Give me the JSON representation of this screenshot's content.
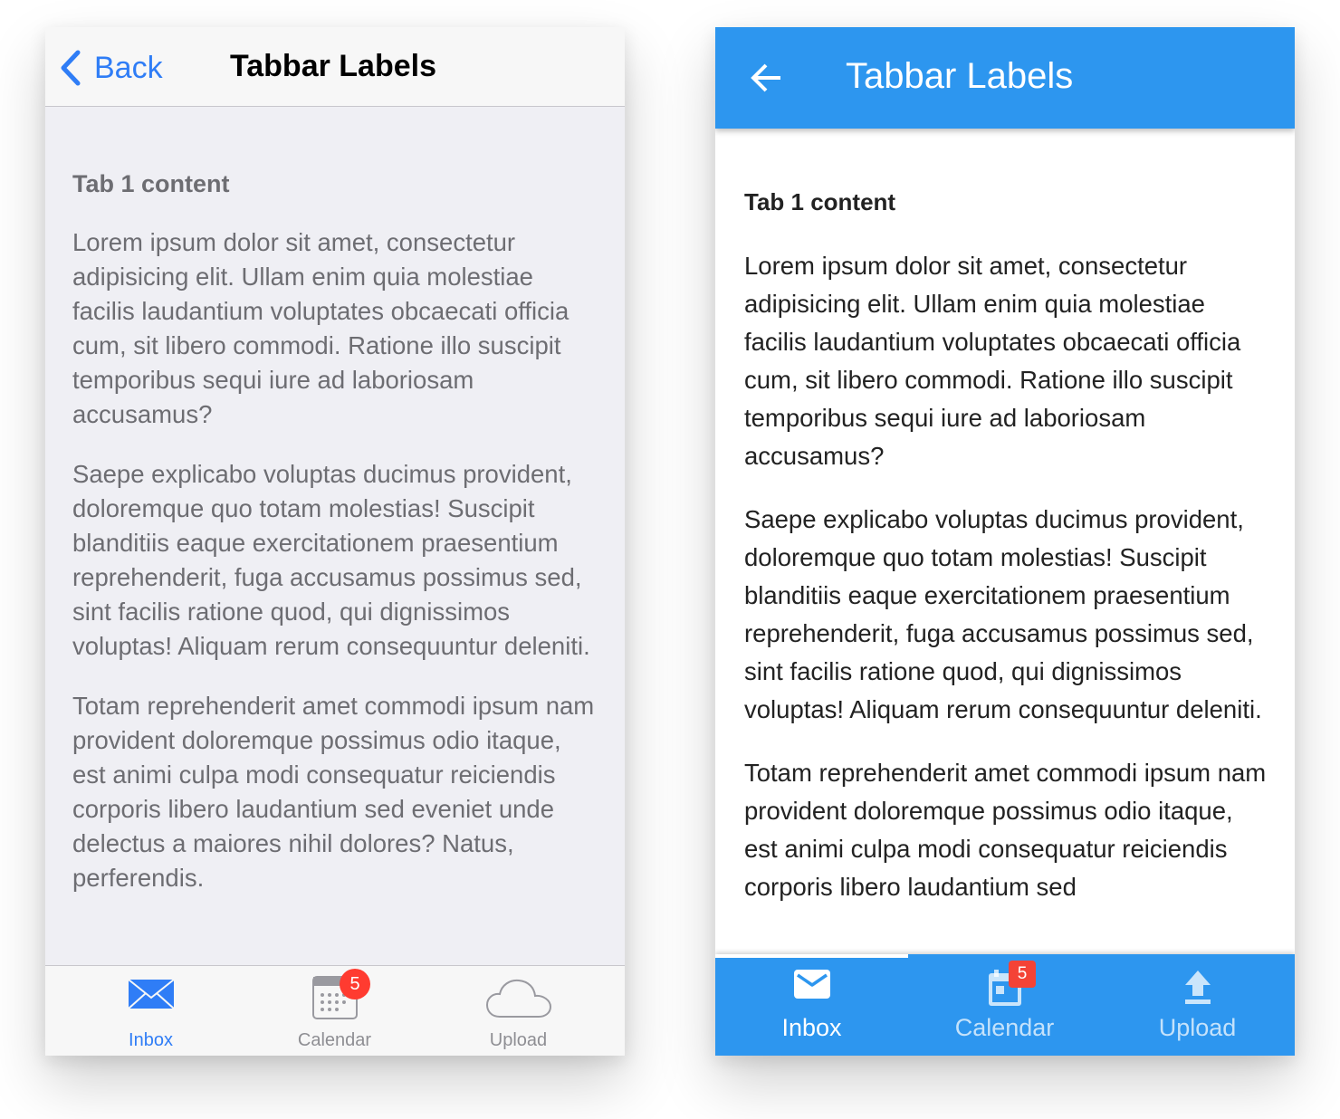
{
  "ios": {
    "nav": {
      "back_label": "Back",
      "title": "Tabbar Labels"
    },
    "content": {
      "heading": "Tab 1 content",
      "paragraphs": [
        "Lorem ipsum dolor sit amet, consectetur adipisicing elit. Ullam enim quia molestiae facilis laudantium voluptates obcaecati officia cum, sit libero commodi. Ratione illo suscipit temporibus sequi iure ad laboriosam accusamus?",
        "Saepe explicabo voluptas ducimus provident, doloremque quo totam molestias! Suscipit blanditiis eaque exercitationem praesentium reprehenderit, fuga accusamus possimus sed, sint facilis ratione quod, qui dignissimos voluptas! Aliquam rerum consequuntur deleniti.",
        "Totam reprehenderit amet commodi ipsum nam provident doloremque possimus odio itaque, est animi culpa modi consequatur reiciendis corporis libero laudantium sed eveniet unde delectus a maiores nihil dolores? Natus, perferendis."
      ]
    },
    "tabs": [
      {
        "label": "Inbox",
        "icon": "envelope-icon",
        "active": true
      },
      {
        "label": "Calendar",
        "icon": "calendar-icon",
        "badge": "5"
      },
      {
        "label": "Upload",
        "icon": "cloud-icon"
      }
    ],
    "colors": {
      "accent": "#2f7df6",
      "badge": "#ff3b30"
    }
  },
  "android": {
    "toolbar": {
      "title": "Tabbar Labels",
      "back_icon": "arrow-back-icon"
    },
    "content": {
      "heading": "Tab 1 content",
      "paragraphs": [
        "Lorem ipsum dolor sit amet, consectetur adipisicing elit. Ullam enim quia molestiae facilis laudantium voluptates obcaecati officia cum, sit libero commodi. Ratione illo suscipit temporibus sequi iure ad laboriosam accusamus?",
        "Saepe explicabo voluptas ducimus provident, doloremque quo totam molestias! Suscipit blanditiis eaque exercitationem praesentium reprehenderit, fuga accusamus possimus sed, sint facilis ratione quod, qui dignissimos voluptas! Aliquam rerum consequuntur deleniti.",
        "Totam reprehenderit amet commodi ipsum nam provident doloremque possimus odio itaque, est animi culpa modi consequatur reiciendis corporis libero laudantium sed"
      ]
    },
    "tabs": [
      {
        "label": "Inbox",
        "icon": "email-icon",
        "active": true
      },
      {
        "label": "Calendar",
        "icon": "calendar-icon",
        "badge": "5"
      },
      {
        "label": "Upload",
        "icon": "upload-icon"
      }
    ],
    "colors": {
      "primary": "#2d96ef",
      "badge": "#f44336"
    }
  }
}
